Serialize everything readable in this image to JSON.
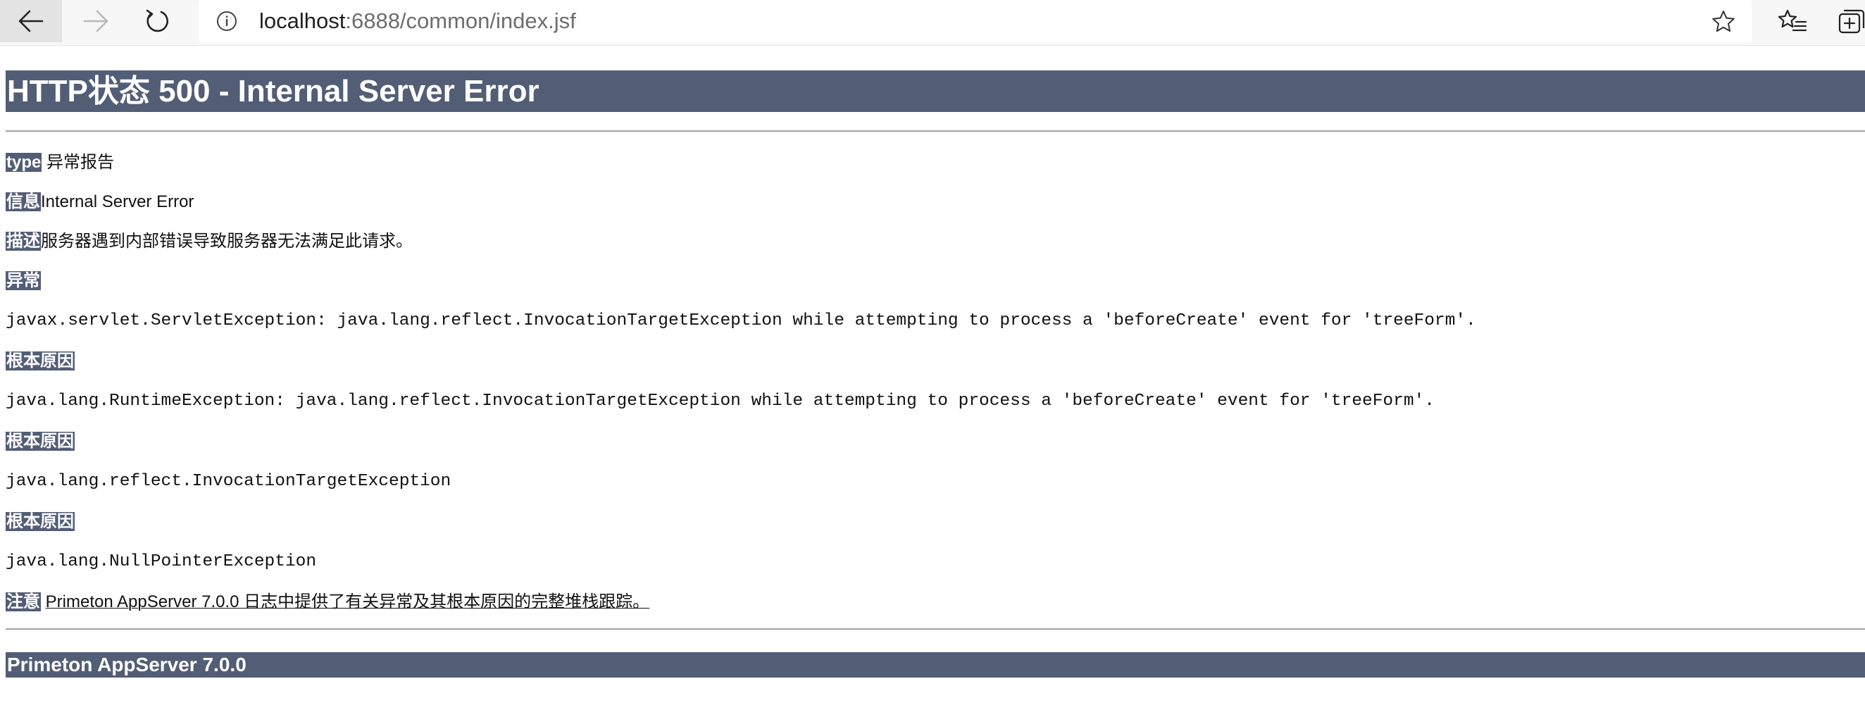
{
  "browser": {
    "url": {
      "host": "localhost",
      "path": ":6888/common/index.jsf"
    },
    "icons": {
      "back": "arrow-left-icon",
      "forward": "arrow-right-icon",
      "reload": "reload-icon",
      "info": "info-icon",
      "favorite": "star-icon",
      "favorites": "favorites-icon",
      "collections": "collections-icon"
    }
  },
  "page": {
    "title": "HTTP状态 500 - Internal Server Error",
    "type": {
      "label": "type",
      "value": " 异常报告"
    },
    "message": {
      "label": "信息",
      "value": "Internal Server Error"
    },
    "description": {
      "label": "描述",
      "value": "服务器遇到内部错误导致服务器无法满足此请求。"
    },
    "exception": {
      "label": "异常",
      "value": "javax.servlet.ServletException: java.lang.reflect.InvocationTargetException while attempting to process a 'beforeCreate' event for 'treeForm'."
    },
    "root_causes": [
      {
        "label": "根本原因",
        "value": "java.lang.RuntimeException: java.lang.reflect.InvocationTargetException while attempting to process a 'beforeCreate' event for 'treeForm'."
      },
      {
        "label": "根本原因",
        "value": "java.lang.reflect.InvocationTargetException"
      },
      {
        "label": "根本原因",
        "value": "java.lang.NullPointerException"
      }
    ],
    "note": {
      "label": "注意",
      "value": "Primeton AppServer 7.0.0 日志中提供了有关异常及其根本原因的完整堆栈跟踪。"
    },
    "footer": "Primeton AppServer 7.0.0"
  },
  "colors": {
    "header_bg": "#525d76",
    "header_text": "#ffffff",
    "toolbar_bg": "#f7f7f7"
  }
}
